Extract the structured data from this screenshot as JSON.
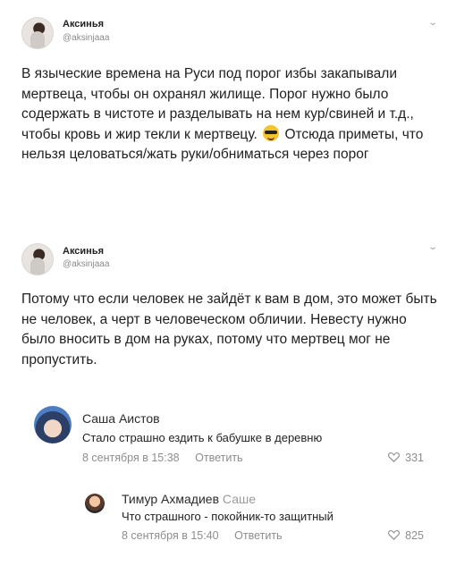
{
  "tweets": [
    {
      "name": "Аксинья",
      "handle": "@aksinjaaa",
      "text_before_emoji": "В языческие времена на Руси под порог избы закапывали мертвеца, чтобы он охранял жилище. Порог нужно было содержать в чистоте и разделывать на нем кур/свиней и т.д., чтобы кровь и жир текли к мертвецу.",
      "emoji_icon": "sunglasses-emoji-icon",
      "text_after_emoji": "Отсюда приметы, что нельзя целоваться/жать руки/обниматься через порог"
    },
    {
      "name": "Аксинья",
      "handle": "@aksinjaaa",
      "text": "Потому что если человек не зайдёт к вам в дом, это может быть не человек, а черт в человеческом обличии. Невесту нужно было вносить в дом на руках, потому что мертвец мог не пропустить."
    }
  ],
  "comments": [
    {
      "name": "Саша Аистов",
      "text": "Стало страшно ездить к бабушке в деревню",
      "date": "8 сентября в 15:38",
      "reply_label": "Ответить",
      "likes": "331"
    },
    {
      "name": "Тимур Ахмадиев",
      "reply_to": "Саше",
      "text": "Что страшного - покойник-то защитный",
      "date": "8 сентября в 15:40",
      "reply_label": "Ответить",
      "likes": "825"
    }
  ],
  "icons": {
    "chevron": "chevron-down-icon",
    "heart": "heart-icon"
  }
}
